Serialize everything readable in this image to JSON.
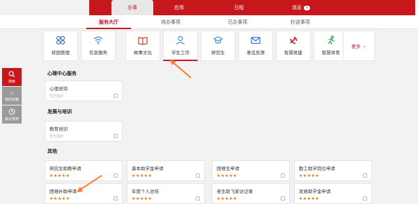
{
  "top_tabs": [
    {
      "label": "办事",
      "active": true
    },
    {
      "label": "应用",
      "active": false
    },
    {
      "label": "日程",
      "active": false
    },
    {
      "label": "消息",
      "active": false,
      "badge": "1"
    }
  ],
  "subnav": [
    {
      "label": "服务大厅",
      "active": true
    },
    {
      "label": "待办事项",
      "active": false
    },
    {
      "label": "已办事项",
      "active": false
    },
    {
      "label": "抄送事项",
      "active": false
    }
  ],
  "apps": [
    {
      "label": "校园管理",
      "icon": "grid-icon"
    },
    {
      "label": "信息服务",
      "icon": "wifi-icon"
    },
    {
      "label": "故事文化",
      "icon": "book-icon"
    },
    {
      "label": "学生工作",
      "icon": "user-icon",
      "active": true
    },
    {
      "label": "研究生",
      "icon": "graduation-cap-icon"
    },
    {
      "label": "意见反馈",
      "icon": "mail-icon"
    },
    {
      "label": "智慧党建",
      "icon": "party-emblem-icon"
    },
    {
      "label": "智慧体育",
      "icon": "run-icon"
    }
  ],
  "more_label": "更多",
  "side": [
    {
      "label": "搜索",
      "icon": "search-icon",
      "active": true
    },
    {
      "label": "我的收藏",
      "icon": "star-icon",
      "active": false
    },
    {
      "label": "最近使用",
      "icon": "clock-icon",
      "active": false
    }
  ],
  "sections": [
    {
      "title": "心理中心服务",
      "cards": [
        {
          "title": "心理咨询",
          "sub": "暂无描述"
        }
      ]
    },
    {
      "title": "发展与培训",
      "cards": [
        {
          "title": "教育培训",
          "sub": "暂无描述"
        }
      ]
    },
    {
      "title": "其他",
      "cards": [
        {
          "title": "研究生助教申请",
          "stars": "★★★★★"
        },
        {
          "title": "基本助学金申请",
          "stars": "★★★★★"
        },
        {
          "title": "困难生申请",
          "stars": "★★★★★"
        },
        {
          "title": "勤工助学岗位申请",
          "stars": "★★★★★"
        },
        {
          "title": "困难补助申请",
          "stars": "★★★★★"
        },
        {
          "title": "年度个人总结",
          "stars": "★★★★★"
        },
        {
          "title": "老生助飞家访记录",
          "stars": "★★★★★"
        },
        {
          "title": "发展助学金申请",
          "stars": "★★★★★"
        }
      ]
    }
  ],
  "colors": {
    "brand_red": "#c8161d",
    "star_orange": "#ff6a00",
    "arrow_orange": "#ff7a2f"
  }
}
